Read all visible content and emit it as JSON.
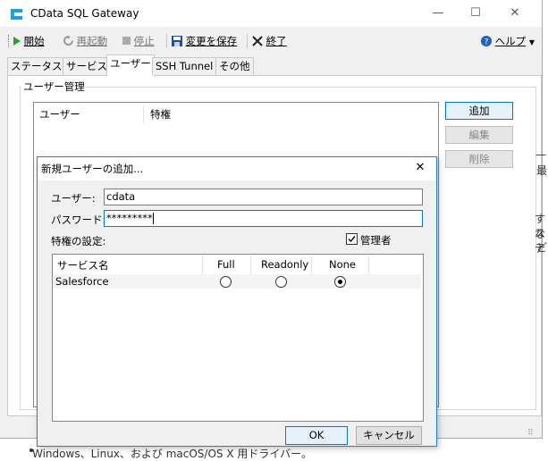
{
  "window": {
    "title": "CData SQL Gateway",
    "minimize": "—",
    "maximize": "☐",
    "close": "✕"
  },
  "toolbar": {
    "start_label": "開始",
    "restart_label": "再起動",
    "stop_label": "停止",
    "save_label": "変更を保存",
    "exit_label": "終了",
    "help_label": "ヘルプ"
  },
  "tabs": [
    {
      "label": "ステータス"
    },
    {
      "label": "サービス"
    },
    {
      "label": "ユーザー",
      "active": true
    },
    {
      "label": "SSH Tunnel"
    },
    {
      "label": "その他"
    }
  ],
  "users_group": {
    "title": "ユーザー管理",
    "columns": [
      "ユーザー",
      "特権"
    ],
    "add_label": "追加",
    "edit_label": "編集",
    "delete_label": "削除"
  },
  "background_fragments": {
    "right_1": "—",
    "right_2": "最",
    "right_3": "すな",
    "right_4": "ステ",
    "right_5": "ど",
    "bottom": "Windows、Linux、および macOS/OS X 用ドライバー。"
  },
  "dialog": {
    "title": "新規ユーザーの追加...",
    "close": "✕",
    "user_label": "ユーザー:",
    "user_value": "cdata",
    "password_label": "パスワード:",
    "password_value": "*********",
    "privileges_label": "特権の設定:",
    "admin_label": "管理者",
    "admin_checked": true,
    "table_headers": [
      "サービス名",
      "Full",
      "Readonly",
      "None"
    ],
    "rows": [
      {
        "service": "Salesforce",
        "selected": "None"
      }
    ],
    "ok_label": "OK",
    "cancel_label": "キャンセル"
  },
  "colors": {
    "accent": "#0078d7",
    "logo": "#1aa1e0",
    "save_icon": "#1f4f99",
    "exit_icon": "#222222",
    "help_icon": "#1f5fbf",
    "start_icon": "#2e9e2e"
  }
}
